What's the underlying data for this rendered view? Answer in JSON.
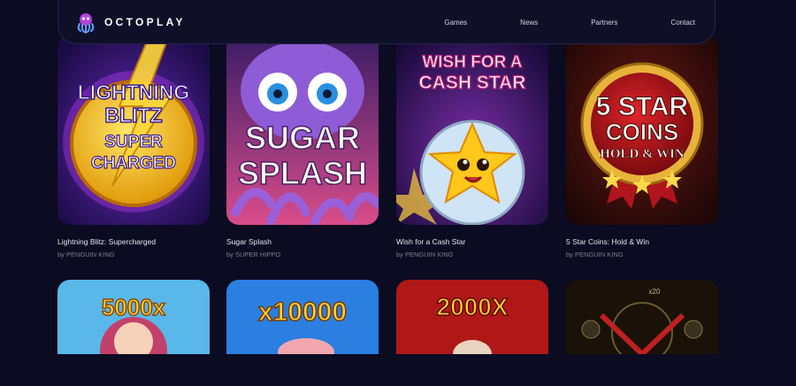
{
  "brand": {
    "name": "OCTOPLAY"
  },
  "nav": {
    "links": [
      "Games",
      "News",
      "Partners",
      "Contact"
    ]
  },
  "games": [
    {
      "title": "Lightning Blitz: Supercharged",
      "provider": "by PENGUIN KING",
      "art": [
        "LIGHTNING",
        "BLITZ",
        "SUPER",
        "CHARGED"
      ]
    },
    {
      "title": "Sugar Splash",
      "provider": "by SUPER HIPPO",
      "art": [
        "SUGAR",
        "SPLASH"
      ]
    },
    {
      "title": "Wish for a Cash Star",
      "provider": "by PENGUIN KING",
      "art": [
        "WISH FOR A",
        "CASH STAR"
      ]
    },
    {
      "title": "5 Star Coins: Hold & Win",
      "provider": "by PENGUIN KING",
      "art": [
        "5 STAR",
        "COINS",
        "HOLD & WIN"
      ]
    }
  ],
  "row2_art": [
    "5000x",
    "x10000",
    "2000X",
    "x20"
  ],
  "colors": {
    "background": "#0b0b22",
    "nav_bg": "#0f0f28",
    "text": "#e6e6f0",
    "muted": "#7c7c96"
  }
}
